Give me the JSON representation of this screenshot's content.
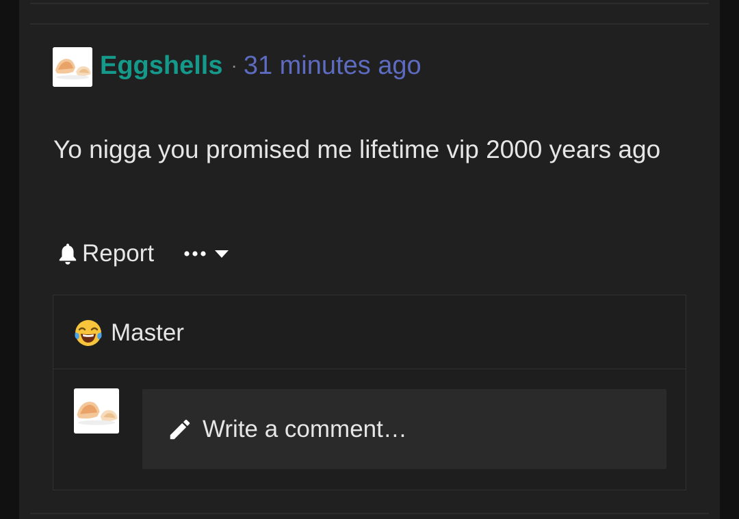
{
  "post": {
    "author": "Eggshells",
    "separator": "·",
    "time": "31 minutes ago",
    "body": "Yo nigga you promised me lifetime vip 2000 years ago"
  },
  "actions": {
    "report_label": "Report",
    "report_icon": "bell-icon",
    "more_icon": "ellipsis-icon",
    "dropdown_icon": "caret-down-icon"
  },
  "replies": {
    "reaction_icon": "laughing-crying-emoji-icon",
    "reaction_user": "Master",
    "comment_placeholder": "Write a comment…",
    "comment_icon": "pencil-icon"
  },
  "colors": {
    "author": "#14998a",
    "time": "#5d6bc0",
    "background": "#202020",
    "text": "#e6e6e6"
  }
}
